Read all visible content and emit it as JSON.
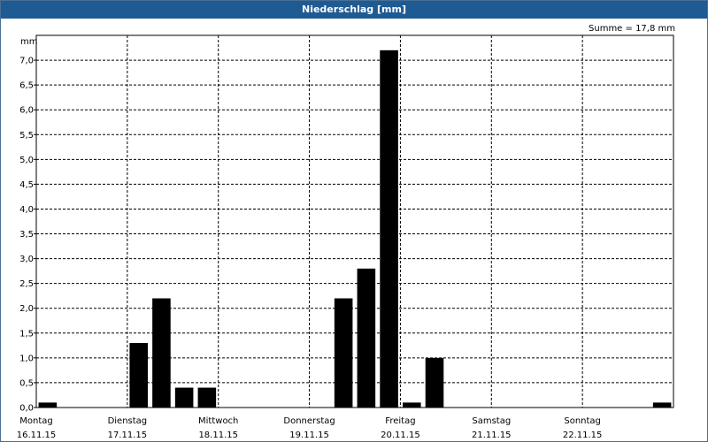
{
  "window": {
    "title": "Niederschlag [mm]"
  },
  "chart_data": {
    "type": "bar",
    "title": "Niederschlag [mm]",
    "ylabel": "mm",
    "ylim": [
      0,
      7.5
    ],
    "yticks": [
      "0,0",
      "0,5",
      "1,0",
      "1,5",
      "2,0",
      "2,5",
      "3,0",
      "3,5",
      "4,0",
      "4,5",
      "5,0",
      "5,5",
      "6,0",
      "6,5",
      "7,0"
    ],
    "annotation": "Summe = 17,8 mm",
    "days": [
      {
        "name": "Montag",
        "date": "16.11.15"
      },
      {
        "name": "Dienstag",
        "date": "17.11.15"
      },
      {
        "name": "Mittwoch",
        "date": "18.11.15"
      },
      {
        "name": "Donnerstag",
        "date": "19.11.15"
      },
      {
        "name": "Freitag",
        "date": "20.11.15"
      },
      {
        "name": "Samstag",
        "date": "21.11.15"
      },
      {
        "name": "Sonntag",
        "date": "22.11.15"
      }
    ],
    "interval_hours": 6,
    "values": [
      0.1,
      0,
      0,
      0,
      1.3,
      2.2,
      0.4,
      0.4,
      0,
      0,
      0,
      0,
      0,
      2.2,
      2.8,
      7.2,
      0.1,
      1.0,
      0,
      0,
      0,
      0,
      0,
      0,
      0,
      0,
      0,
      0.1
    ],
    "bar_color": "#000000",
    "grid": true
  }
}
